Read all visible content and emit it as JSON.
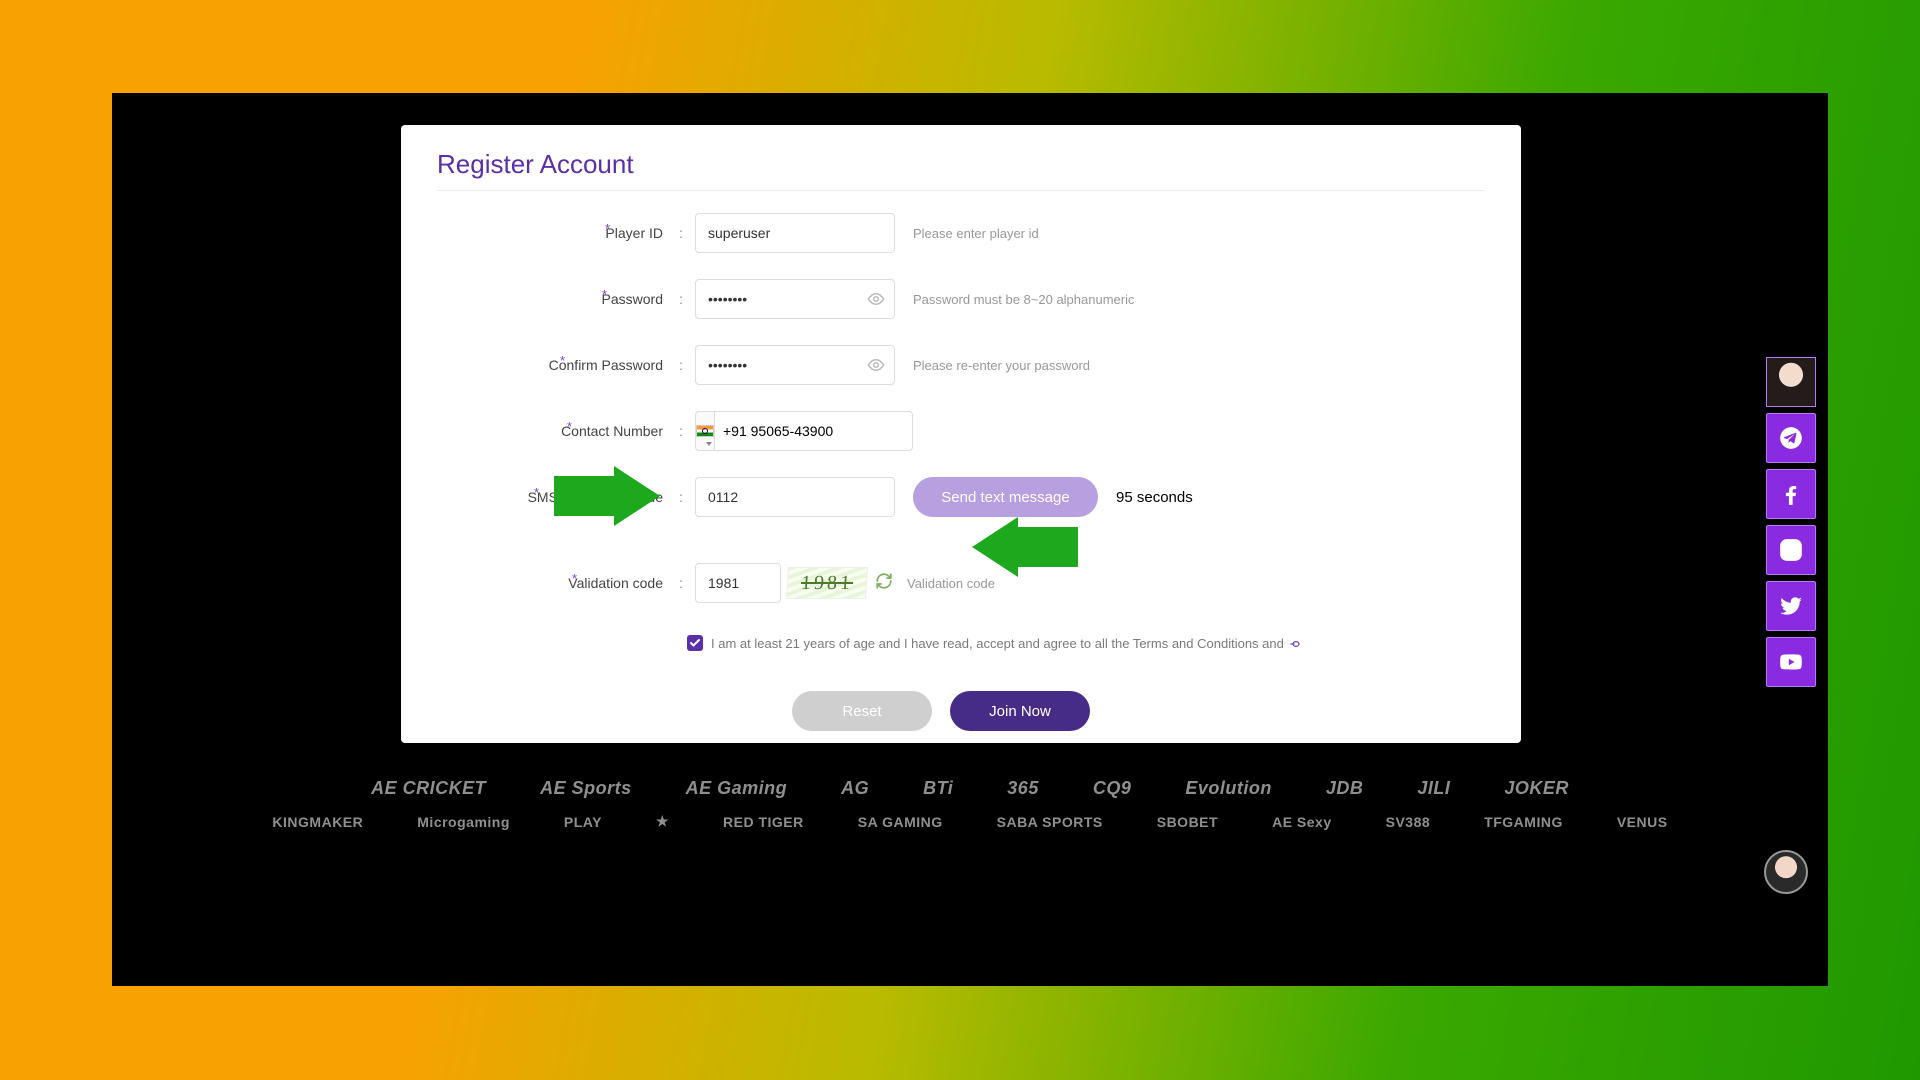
{
  "title": "Register Account",
  "fields": {
    "player": {
      "label": "Player ID",
      "value": "superuser",
      "hint": "Please enter player id"
    },
    "password": {
      "label": "Password",
      "value": "••••••••",
      "hint": "Password must be 8~20 alphanumeric"
    },
    "confirm": {
      "label": "Confirm Password",
      "value": "••••••••",
      "hint": "Please re-enter your password"
    },
    "contact": {
      "label": "Contact Number",
      "value": "+91 95065-43900"
    },
    "sms": {
      "label": "SMS verification code",
      "value": "0112",
      "button": "Send text message",
      "timer": "95 seconds"
    },
    "validation": {
      "label": "Validation code",
      "value": "1981",
      "captcha": "1981",
      "hint": "Validation code"
    }
  },
  "consent": {
    "checked": true,
    "text": "I am at least 21 years of age and I have read, accept and agree to all the Terms and Conditions and"
  },
  "buttons": {
    "reset": "Reset",
    "join": "Join Now"
  },
  "providers_row1": [
    "AE CRICKET",
    "AE Sports",
    "AE Gaming",
    "AG",
    "BTi",
    "365",
    "CQ9",
    "Evolution",
    "JDB",
    "JILI",
    "JOKER"
  ],
  "providers_row2": [
    "KINGMAKER",
    "Microgaming",
    "PLAY",
    "★",
    "RED TIGER",
    "SA GAMING",
    "SABA SPORTS",
    "SBOBET",
    "AE Sexy",
    "SV388",
    "TFGAMING",
    "VENUS"
  ]
}
